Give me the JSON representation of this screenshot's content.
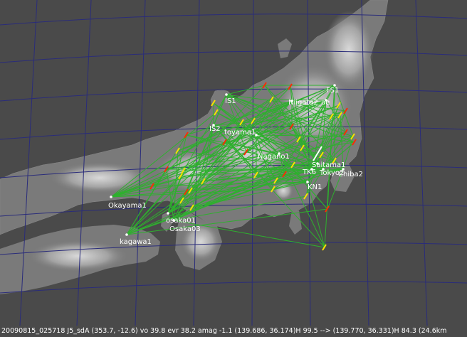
{
  "colors": {
    "sea": "#4a4a4a",
    "land_low": "#6e6e6e",
    "land_high": "#cfcfcf",
    "graticule": "#2a2c7a",
    "link": "#2eb02e",
    "station": "#ffffff",
    "label": "#ffffff",
    "marker_red": "#ff2a00",
    "marker_yellow": "#ffe100"
  },
  "stations": [
    {
      "id": "IS1",
      "label": "IS1"
    },
    {
      "id": "IS2",
      "label": "IS2"
    },
    {
      "id": "toyama1",
      "label": "toyama1_"
    },
    {
      "id": "Niigata2",
      "label": "Niigata2"
    },
    {
      "id": "ae",
      "label": "ae"
    },
    {
      "id": "FS1",
      "label": "FS1"
    },
    {
      "id": "Nagano1",
      "label": "Nagano1"
    },
    {
      "id": "Saitama1",
      "label": "Saitama1"
    },
    {
      "id": "TK6",
      "label": "TK6"
    },
    {
      "id": "Tokyo2",
      "label": "Tokyo2"
    },
    {
      "id": "Chiba2",
      "label": "Chiba2"
    },
    {
      "id": "KN1",
      "label": "KN1"
    },
    {
      "id": "Okayama1",
      "label": "Okayama1"
    },
    {
      "id": "osaka01",
      "label": "osaka01"
    },
    {
      "id": "Osaka03",
      "label": "Osaka03"
    },
    {
      "id": "kagawa1",
      "label": "kagawa1"
    }
  ],
  "status": "20090815_025718  J5_sdA (353.7, -12.6) vo 39.8 evr 38.2 amag -1.1  (139.686, 36.174)H 99.5 --> (139.770, 36.331)H 84.3 (24.6km"
}
